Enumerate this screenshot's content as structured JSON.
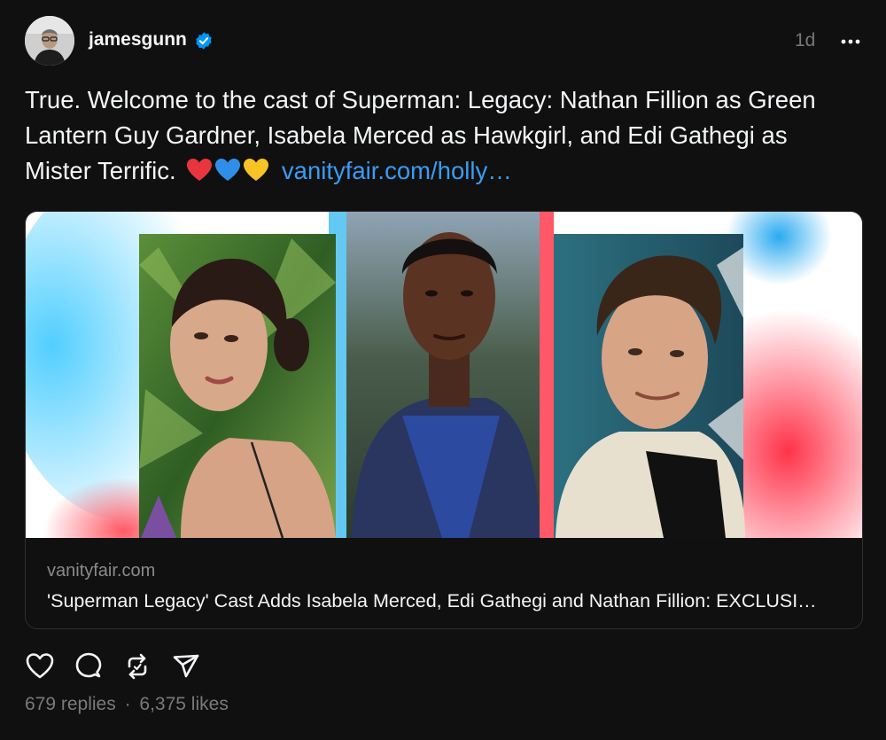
{
  "post": {
    "username": "jamesgunn",
    "time": "1d",
    "text": "True. Welcome to the cast of Superman: Legacy: Nathan Fillion as Green Lantern Guy Gardner, Isabela Merced as Hawkgirl, and Edi Gathegi as Mister Terrific.",
    "emojis": [
      "red-heart",
      "blue-heart",
      "yellow-heart"
    ],
    "link_text": "vanityfair.com/holly…"
  },
  "card": {
    "domain": "vanityfair.com",
    "title": "'Superman Legacy' Cast Adds Isabela Merced, Edi Gathegi and Nathan Fillion: EXCLUSI…"
  },
  "actions": [
    "heart-icon",
    "comment-icon",
    "repost-icon",
    "share-icon"
  ],
  "stats": {
    "replies": "679 replies",
    "separator": "·",
    "likes": "6,375 likes"
  },
  "colors": {
    "background": "#101010",
    "link": "#3a9cf5",
    "verified": "#0095f6",
    "muted": "#7a7a7a"
  }
}
